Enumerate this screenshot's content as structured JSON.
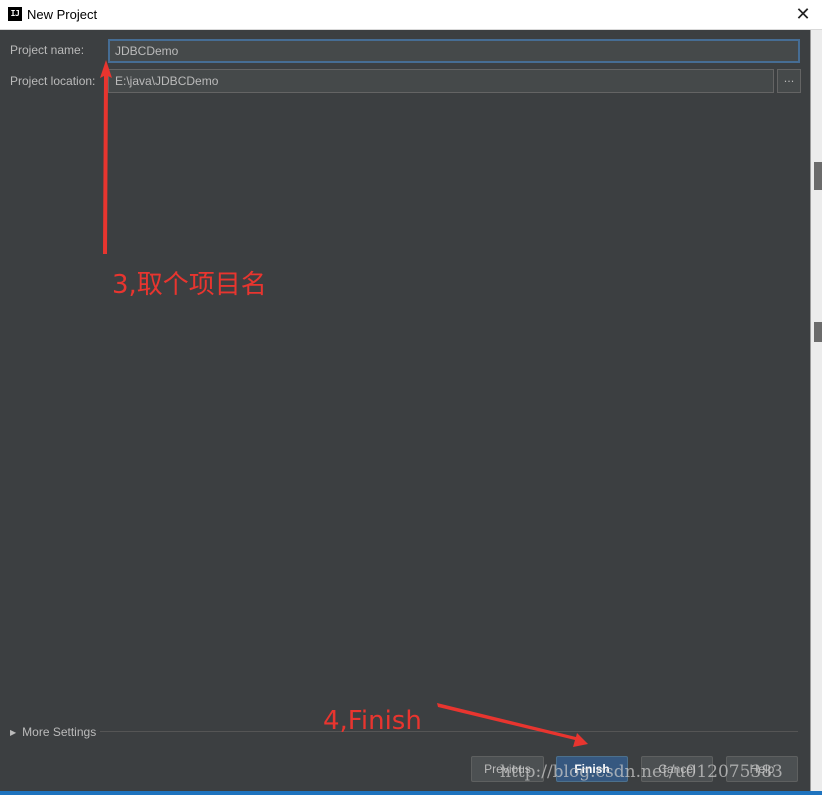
{
  "window": {
    "icon_text": "IJ",
    "title": "New Project",
    "close_glyph": "✕"
  },
  "form": {
    "project_name_label": "Project name:",
    "project_name_value": "JDBCDemo",
    "project_location_label": "Project location:",
    "project_location_value": "E:\\java\\JDBCDemo",
    "browse_label": "..."
  },
  "more_settings": {
    "label": "More Settings",
    "expanded": false
  },
  "buttons": {
    "previous": "Previous",
    "finish": "Finish",
    "cancel": "Cancel",
    "help": "Help"
  },
  "annotations": {
    "step3": "3,取个项目名",
    "step4": "4,Finish",
    "color": "#e8352f"
  },
  "watermark": "http://blog.csdn.net/u012075383",
  "icons": [
    "app-logo-icon",
    "close-icon",
    "triangle-right-icon",
    "arrow-annotation-icon"
  ]
}
